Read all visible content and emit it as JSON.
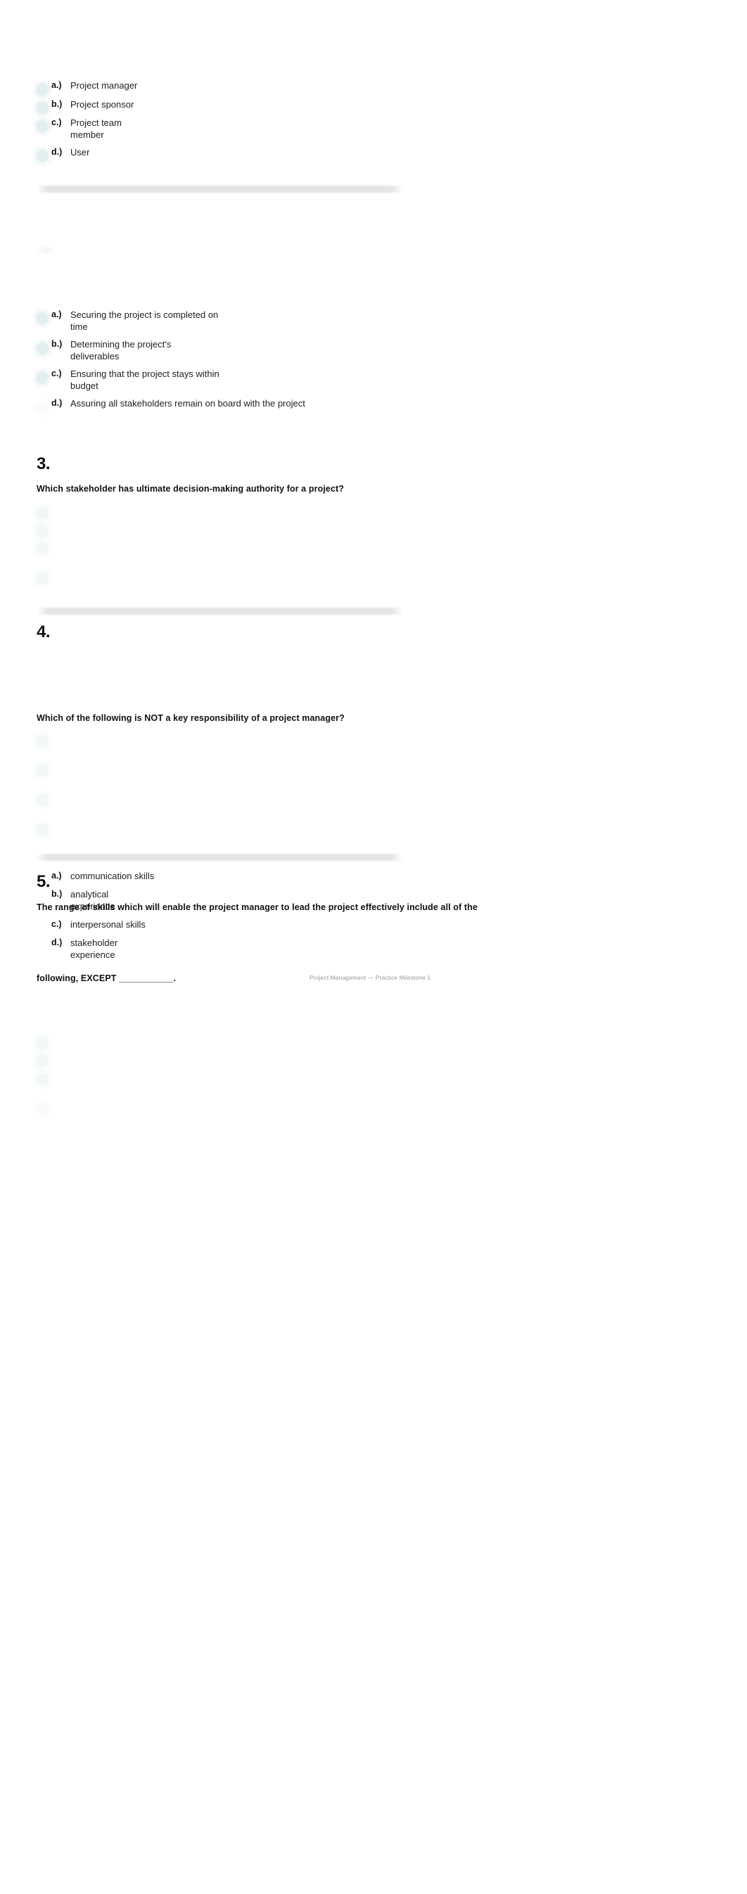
{
  "document": {
    "footer_label": "Project Management — Practice Milestone 1",
    "accent_radio_color": "#dfeced",
    "divider_color": "#e4e4e4",
    "text_color": "#1a1a1a",
    "footer_color": "#999999"
  },
  "questions": [
    {
      "number": "",
      "prompt": "",
      "options": [
        {
          "letter": "a.)",
          "text": "Project manager"
        },
        {
          "letter": "b.)",
          "text": "Project sponsor"
        },
        {
          "letter": "c.)",
          "text": "Project team\nmember"
        },
        {
          "letter": "d.)",
          "text": "User"
        }
      ]
    },
    {
      "number": "",
      "prompt": "",
      "options": [
        {
          "letter": "a.)",
          "text": "Securing the project is completed on\ntime"
        },
        {
          "letter": "b.)",
          "text": "Determining the project's\ndeliverables"
        },
        {
          "letter": "c.)",
          "text": "Ensuring that the project stays within\nbudget"
        },
        {
          "letter": "d.)",
          "text": "Assuring all stakeholders remain on board with the project"
        }
      ]
    },
    {
      "number": "3.",
      "prompt": "Which stakeholder has ultimate decision-making authority for a project?",
      "options": []
    },
    {
      "number": "4.",
      "prompt": "Which of the following is NOT a key responsibility of a project manager?",
      "options": []
    },
    {
      "number": "5.",
      "prompt_line_1": "The range of skills which will enable the project manager to lead the project effectively include all of the",
      "prompt_line_2": "following, EXCEPT ___________.",
      "options": [
        {
          "letter": "a.)",
          "text": "communication skills"
        },
        {
          "letter": "b.)",
          "text": "analytical\nexperience"
        },
        {
          "letter": "c.)",
          "text": "interpersonal skills"
        },
        {
          "letter": "d.)",
          "text": "stakeholder\nexperience"
        }
      ]
    }
  ]
}
